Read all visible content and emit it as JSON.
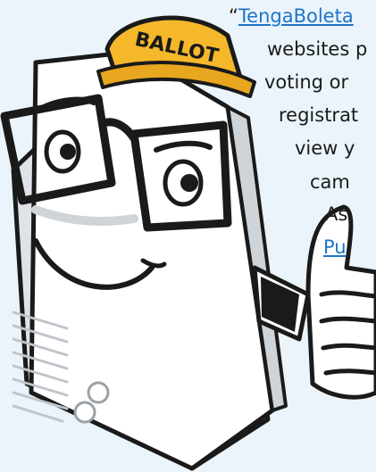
{
  "mascot": {
    "hat_text": "BALLOT",
    "colors": {
      "hat": "#f5b82a",
      "paper": "#ffffff",
      "outline": "#1a1a1a",
      "background": "#eaf4fa",
      "link": "#1e74c9"
    }
  },
  "text": {
    "lines": [
      {
        "prefix": "“",
        "link": "TengaBoleta"
      },
      {
        "text": "websites p"
      },
      {
        "text": "voting or"
      },
      {
        "text": "registrat"
      },
      {
        "text": "view y"
      },
      {
        "text": "cam"
      },
      {
        "text": "As"
      },
      {
        "link": "Pu"
      }
    ]
  }
}
